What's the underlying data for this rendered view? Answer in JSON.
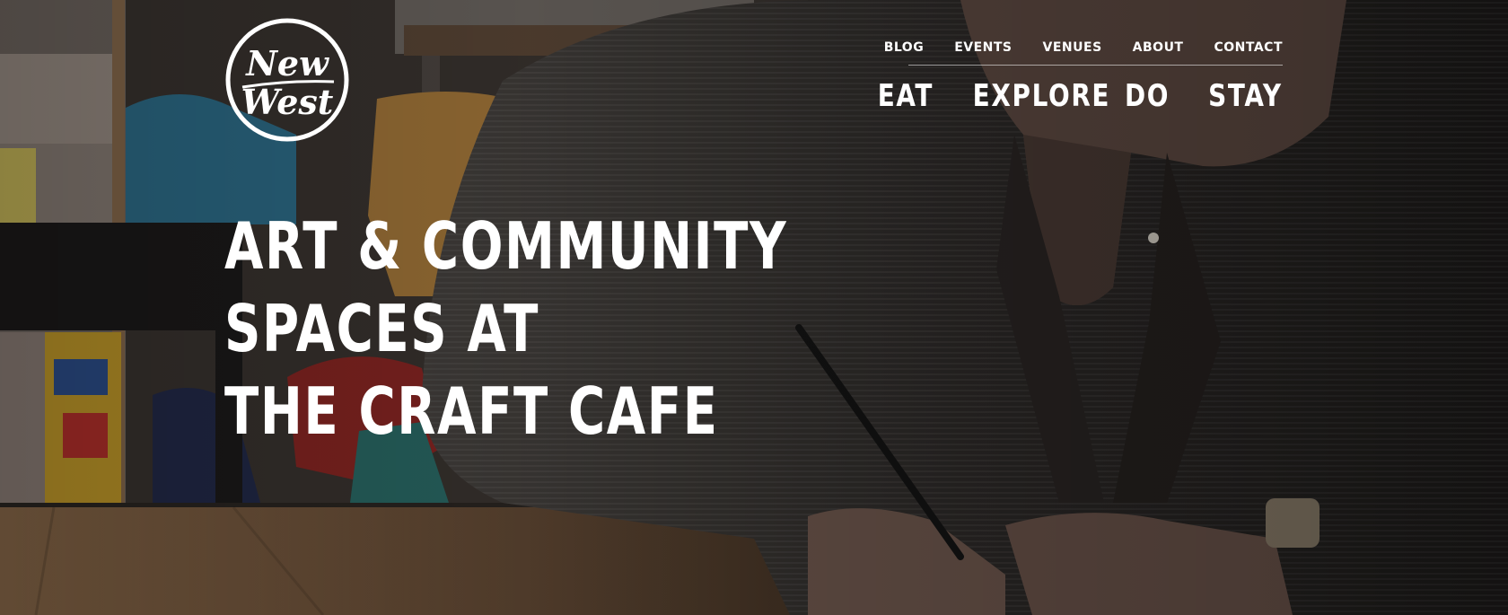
{
  "logo": {
    "line1": "New",
    "line2": "West"
  },
  "utility_nav": [
    {
      "label": "BLOG"
    },
    {
      "label": "EVENTS"
    },
    {
      "label": "VENUES"
    },
    {
      "label": "ABOUT"
    },
    {
      "label": "CONTACT"
    }
  ],
  "main_nav": [
    {
      "label": "EAT"
    },
    {
      "label": "EXPLORE"
    },
    {
      "label": "DO"
    },
    {
      "label": "STAY"
    }
  ],
  "hero": {
    "headline_line1": "ART & COMMUNITY SPACES AT",
    "headline_line2": "THE CRAFT CAFE"
  },
  "colors": {
    "text": "#ffffff",
    "background_dark": "#1a1816"
  }
}
